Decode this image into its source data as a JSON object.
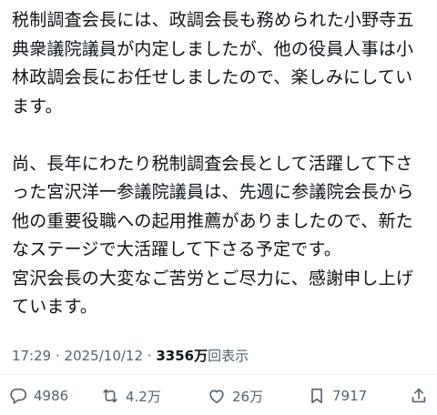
{
  "post": {
    "lines_paragraph_1": [
      "税制調査会長には、政調会長も務められた小野寺五",
      "典衆議院議員が内定しましたが、他の役員人事は小",
      "林政調会長にお任せしましたので、楽しみにしてい",
      "ます。"
    ],
    "lines_paragraph_2": [
      "尚、長年にわたり税制調査会長として活躍して下さ",
      "った宮沢洋一参議院議員は、先週に参議院会長から",
      "他の重要役職への起用推薦がありましたので、新た",
      "なステージで大活躍して下さる予定です。",
      "宮沢会長の大変なご苦労とご尽力に、感謝申し上げ",
      "ています。"
    ]
  },
  "meta": {
    "time": "17:29",
    "separator": " · ",
    "date": "2025/10/12",
    "views_count": "3356万",
    "views_label": "回表示"
  },
  "actions": {
    "replies": "4986",
    "reposts": "4.2万",
    "likes": "26万",
    "bookmarks": "7917"
  },
  "colors": {
    "text": "#0f1419",
    "secondary": "#536471",
    "divider": "#eff3f4"
  },
  "icons": [
    "reply-icon",
    "repost-icon",
    "like-icon",
    "bookmark-icon",
    "share-icon"
  ]
}
